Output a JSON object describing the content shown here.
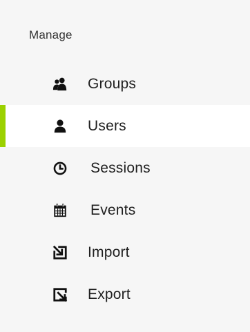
{
  "sidebar": {
    "section_title": "Manage",
    "accent_color": "#9bd100",
    "items": [
      {
        "label": "Groups",
        "icon": "groups-icon",
        "active": false
      },
      {
        "label": "Users",
        "icon": "user-icon",
        "active": true
      },
      {
        "label": "Sessions",
        "icon": "clock-icon",
        "active": false
      },
      {
        "label": "Events",
        "icon": "calendar-icon",
        "active": false
      },
      {
        "label": "Import",
        "icon": "import-icon",
        "active": false
      },
      {
        "label": "Export",
        "icon": "export-icon",
        "active": false
      }
    ]
  }
}
